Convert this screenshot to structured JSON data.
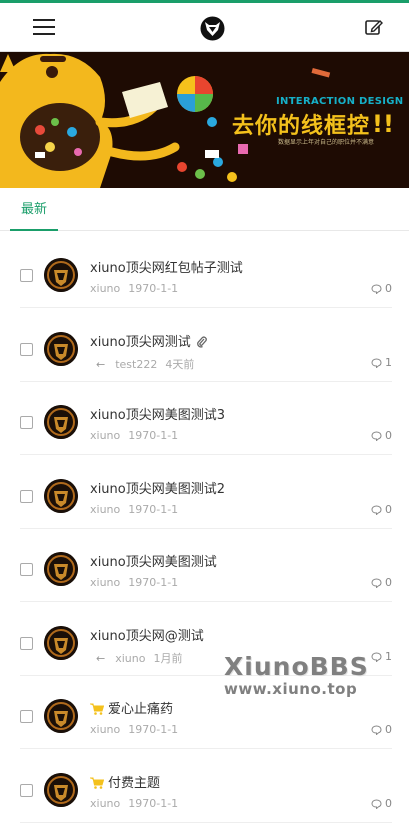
{
  "header": {
    "menu_icon": "hamburger-icon",
    "logo_icon": "fox-logo-icon",
    "compose_icon": "compose-icon"
  },
  "banner": {
    "headline_en": "INTERACTION DESIGN",
    "headline_cn": "去你的线框控",
    "subline": "数据显示上年对自己的职位并不满意"
  },
  "tabs": {
    "latest": "最新"
  },
  "threads": [
    {
      "title": "xiuno顶尖网红包帖子测试",
      "user": "xiuno",
      "date": "1970-1-1",
      "replies": "0",
      "reply_arrow": false,
      "attachment": false,
      "paid": false
    },
    {
      "title": "xiuno顶尖网测试",
      "user": "test222",
      "date": "4天前",
      "replies": "1",
      "reply_arrow": true,
      "attachment": true,
      "paid": false
    },
    {
      "title": "xiuno顶尖网美图测试3",
      "user": "xiuno",
      "date": "1970-1-1",
      "replies": "0",
      "reply_arrow": false,
      "attachment": false,
      "paid": false
    },
    {
      "title": "xiuno顶尖网美图测试2",
      "user": "xiuno",
      "date": "1970-1-1",
      "replies": "0",
      "reply_arrow": false,
      "attachment": false,
      "paid": false
    },
    {
      "title": "xiuno顶尖网美图测试",
      "user": "xiuno",
      "date": "1970-1-1",
      "replies": "0",
      "reply_arrow": false,
      "attachment": false,
      "paid": false
    },
    {
      "title": "xiuno顶尖网@测试",
      "user": "xiuno",
      "date": "1月前",
      "replies": "1",
      "reply_arrow": true,
      "attachment": false,
      "paid": false
    },
    {
      "title": "爱心止痛药",
      "user": "xiuno",
      "date": "1970-1-1",
      "replies": "0",
      "reply_arrow": false,
      "attachment": false,
      "paid": true
    },
    {
      "title": "付费主题",
      "user": "xiuno",
      "date": "1970-1-1",
      "replies": "0",
      "reply_arrow": false,
      "attachment": false,
      "paid": true
    }
  ],
  "watermark": {
    "line1": "XiunoBBS",
    "line2": "www.xiuno.top"
  },
  "colors": {
    "accent": "#1a9e6a",
    "banner_bg": "#1e0b03",
    "banner_yellow": "#f4c11c",
    "cart": "#f4c11c"
  }
}
